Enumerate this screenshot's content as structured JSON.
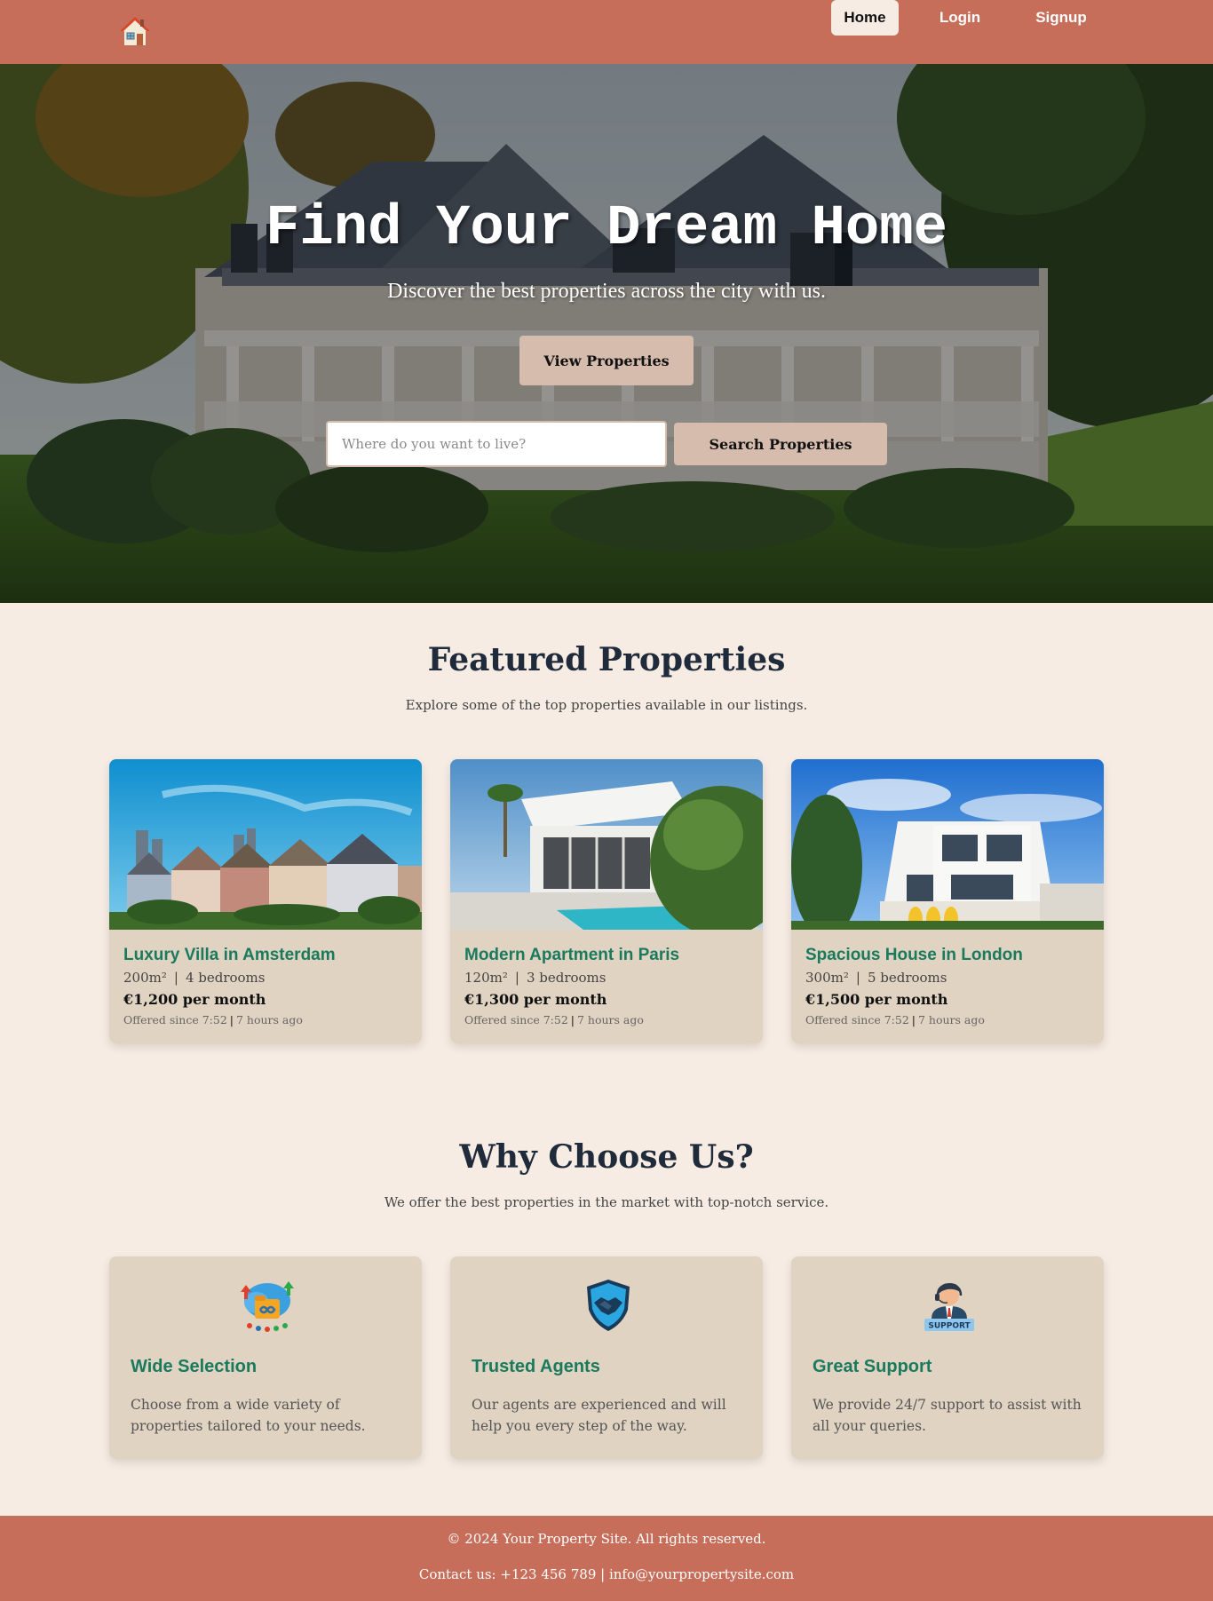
{
  "header": {
    "logo_icon": "house-icon",
    "nav": [
      {
        "label": "Home",
        "active": true
      },
      {
        "label": "Login",
        "active": false
      },
      {
        "label": "Signup",
        "active": false
      }
    ]
  },
  "hero": {
    "title": "Find Your Dream Home",
    "subtitle": "Discover the best properties across the city with us.",
    "view_button": "View Properties",
    "search_placeholder": "Where do you want to live?",
    "search_button": "Search Properties"
  },
  "featured": {
    "title": "Featured Properties",
    "subtitle": "Explore some of the top properties available in our listings.",
    "properties": [
      {
        "name": "Luxury Villa in Amsterdam",
        "area": "200m²",
        "bedrooms": "4 bedrooms",
        "price": "€1,200 per month",
        "offered_time": "Offered since 7:52",
        "offered_ago": "7 hours ago"
      },
      {
        "name": "Modern Apartment in Paris",
        "area": "120m²",
        "bedrooms": "3 bedrooms",
        "price": "€1,300 per month",
        "offered_time": "Offered since 7:52",
        "offered_ago": "7 hours ago"
      },
      {
        "name": "Spacious House in London",
        "area": "300m²",
        "bedrooms": "5 bedrooms",
        "price": "€1,500 per month",
        "offered_time": "Offered since 7:52",
        "offered_ago": "7 hours ago"
      }
    ]
  },
  "why": {
    "title": "Why Choose Us?",
    "subtitle": "We offer the best properties in the market with top-notch service.",
    "features": [
      {
        "icon": "cloud-folder-icon",
        "title": "Wide Selection",
        "description": "Choose from a wide variety of properties tailored to your needs."
      },
      {
        "icon": "handshake-shield-icon",
        "title": "Trusted Agents",
        "description": "Our agents are experienced and will help you every step of the way."
      },
      {
        "icon": "support-agent-icon",
        "title": "Great Support",
        "description": "We provide 24/7 support to assist with all your queries.",
        "badge": "SUPPORT"
      }
    ]
  },
  "footer": {
    "copyright": "© 2024 Your Property Site. All rights reserved.",
    "contact": "Contact us: +123 456 789 | info@yourpropertysite.com"
  },
  "colors": {
    "header_bg": "#c66e5a",
    "page_bg": "#f6ece3",
    "card_bg": "#e0d3c2",
    "button_bg": "#d6bcad",
    "accent_green": "#1a7a5e",
    "heading": "#1f2a3a"
  }
}
